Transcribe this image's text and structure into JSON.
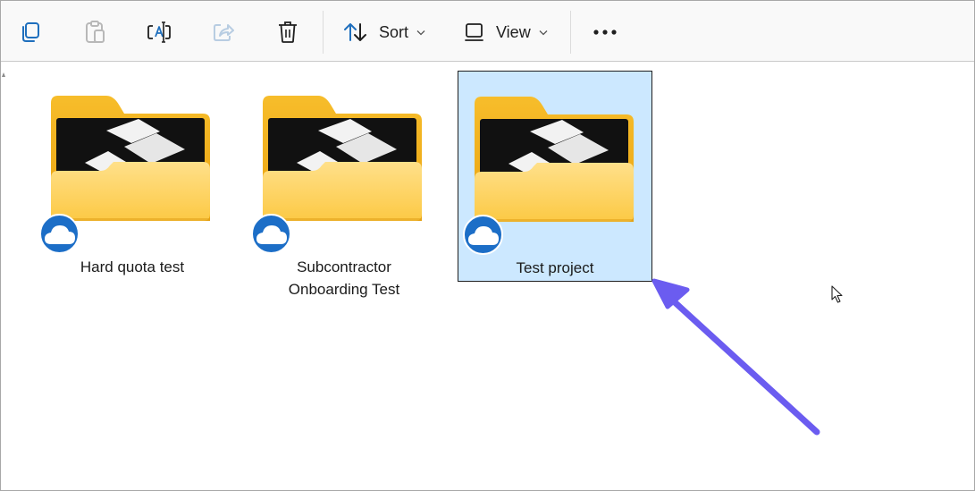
{
  "toolbar": {
    "sort_label": "Sort",
    "view_label": "View"
  },
  "icons": {
    "copy": "copy-icon",
    "paste": "paste-icon",
    "rename": "rename-icon",
    "share": "share-icon",
    "delete": "delete-icon",
    "sort": "sort-arrows-icon",
    "view": "view-icon",
    "more": "more-icon",
    "cloud": "cloud-icon"
  },
  "folders": [
    {
      "label": "Hard quota test",
      "selected": false
    },
    {
      "label": "Subcontractor\nOnboarding Test",
      "selected": false
    },
    {
      "label": "Test project",
      "selected": true
    }
  ],
  "colors": {
    "selection_bg": "#cce8ff",
    "cloud_badge": "#1c6ec7",
    "arrow": "#6b5cf0",
    "folder_back": "#f5b81e",
    "folder_front": "#ffd96b"
  }
}
